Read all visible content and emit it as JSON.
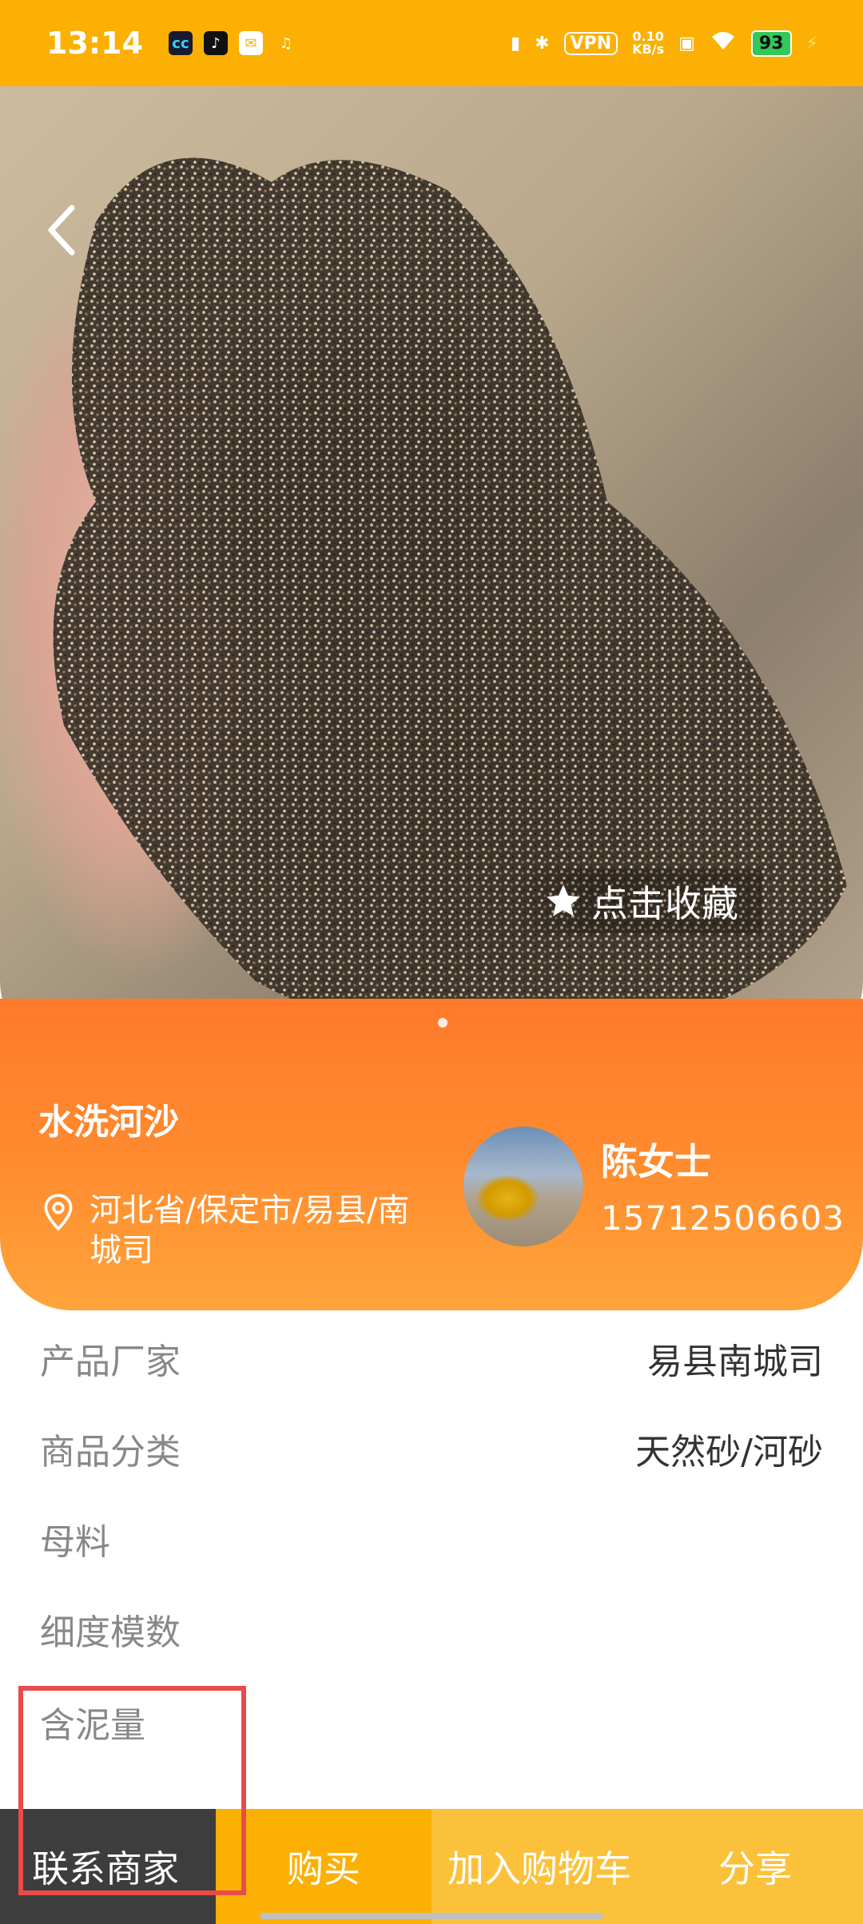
{
  "status_bar": {
    "time": "13:14",
    "icons": [
      "app-cc-icon",
      "tiktok-icon",
      "mail-icon",
      "qq-icon",
      "vibrate-icon",
      "bluetooth-icon",
      "vpn-badge",
      "data-speed",
      "sim-icon",
      "wifi-icon",
      "battery-icon"
    ],
    "vpn": "VPN",
    "speed_value": "0.10",
    "speed_unit": "KB/s",
    "battery": "93"
  },
  "hero": {
    "favorite_label": "点击收藏"
  },
  "product": {
    "title": "水洗河沙",
    "location": "河北省/保定市/易县/南城司"
  },
  "seller": {
    "name": "陈女士",
    "phone": "15712506603"
  },
  "attributes": [
    {
      "label": "产品厂家",
      "value": "易县南城司"
    },
    {
      "label": "商品分类",
      "value": "天然砂/河砂"
    },
    {
      "label": "母料",
      "value": ""
    },
    {
      "label": "细度模数",
      "value": ""
    },
    {
      "label": "含泥量",
      "value": ""
    }
  ],
  "bottom_bar": {
    "contact": "联系商家",
    "buy": "购买",
    "add_cart": "加入购物车",
    "share": "分享"
  },
  "colors": {
    "accent": "#FBB003",
    "orange_card": "#FF8A2E",
    "highlight": "#E94B4B"
  }
}
